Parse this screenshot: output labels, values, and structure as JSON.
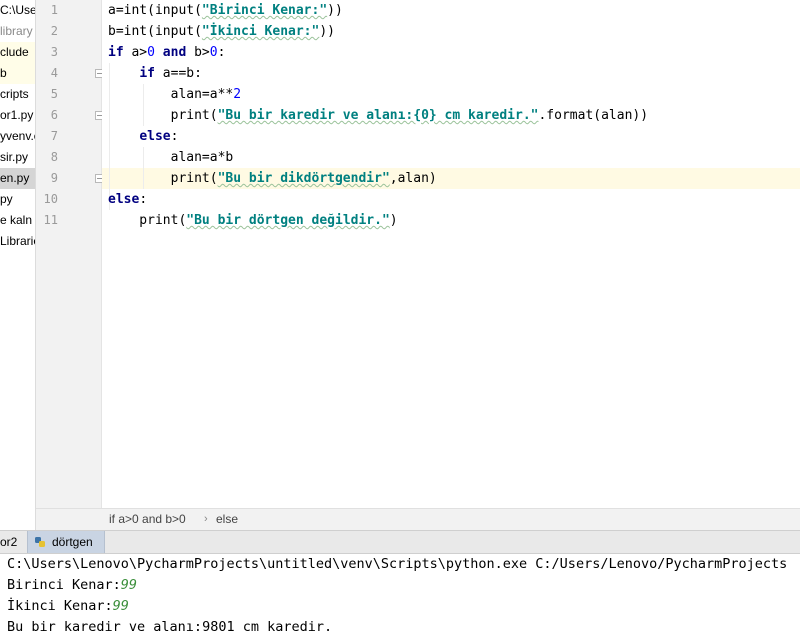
{
  "sidebar": {
    "items": [
      {
        "label": "C:\\Use",
        "dim": false
      },
      {
        "label": "library",
        "dim": true
      },
      {
        "label": "clude",
        "dim": false
      },
      {
        "label": "b",
        "dim": false
      },
      {
        "label": "cripts",
        "dim": false
      },
      {
        "label": "or1.py",
        "dim": false
      },
      {
        "label": "yvenv.c",
        "dim": false
      },
      {
        "label": "sir.py",
        "dim": false
      },
      {
        "label": "en.py",
        "dim": false
      },
      {
        "label": "py",
        "dim": false
      },
      {
        "label": "e kaln",
        "dim": false
      },
      {
        "label": "Librarie",
        "dim": false
      }
    ]
  },
  "editor": {
    "line_numbers": [
      "1",
      "2",
      "3",
      "4",
      "5",
      "6",
      "7",
      "8",
      "9",
      "10",
      "11"
    ],
    "lines": [
      [
        {
          "t": "a=int(input(",
          "c": "blt"
        },
        {
          "t": "\"Birinci Kenar:\"",
          "c": "str"
        },
        {
          "t": "))",
          "c": "blt"
        }
      ],
      [
        {
          "t": "b=int(input(",
          "c": "blt"
        },
        {
          "t": "\"İkinci Kenar:\"",
          "c": "str"
        },
        {
          "t": "))",
          "c": "blt"
        }
      ],
      [
        {
          "t": "if ",
          "c": "kw"
        },
        {
          "t": "a>",
          "c": "blt"
        },
        {
          "t": "0",
          "c": "num"
        },
        {
          "t": " and ",
          "c": "kw"
        },
        {
          "t": "b>",
          "c": "blt"
        },
        {
          "t": "0",
          "c": "num"
        },
        {
          "t": ":",
          "c": "blt"
        }
      ],
      [
        {
          "t": "    ",
          "c": "blt"
        },
        {
          "t": "if ",
          "c": "kw"
        },
        {
          "t": "a==b:",
          "c": "blt"
        }
      ],
      [
        {
          "t": "        alan=a**",
          "c": "blt"
        },
        {
          "t": "2",
          "c": "num"
        }
      ],
      [
        {
          "t": "        print(",
          "c": "blt"
        },
        {
          "t": "\"Bu bir karedir ve alanı:{0} cm karedir.\"",
          "c": "str"
        },
        {
          "t": ".format(alan))",
          "c": "blt"
        }
      ],
      [
        {
          "t": "    ",
          "c": "blt"
        },
        {
          "t": "else",
          "c": "kw"
        },
        {
          "t": ":",
          "c": "blt"
        }
      ],
      [
        {
          "t": "        alan=a*b",
          "c": "blt"
        }
      ],
      [
        {
          "t": "        print(",
          "c": "blt"
        },
        {
          "t": "\"Bu bir dikdörtgendir\"",
          "c": "str"
        },
        {
          "t": ",alan)",
          "c": "blt"
        }
      ],
      [
        {
          "t": "else",
          "c": "kw"
        },
        {
          "t": ":",
          "c": "blt"
        }
      ],
      [
        {
          "t": "    print(",
          "c": "blt"
        },
        {
          "t": "\"Bu bir dörtgen değildir.\"",
          "c": "str"
        },
        {
          "t": ")",
          "c": "blt"
        }
      ]
    ]
  },
  "breadcrumb": {
    "items": [
      "if a>0 and b>0",
      "else"
    ],
    "separator": "›"
  },
  "run_tabs": {
    "tabs": [
      {
        "label": "or2",
        "active": false
      },
      {
        "label": "dörtgen",
        "active": true
      }
    ]
  },
  "console": {
    "lines": [
      [
        {
          "t": "C:\\Users\\Lenovo\\PycharmProjects\\untitled\\venv\\Scripts\\python.exe C:/Users/Lenovo/PycharmProjects",
          "c": "out"
        }
      ],
      [
        {
          "t": "Birinci Kenar:",
          "c": "out"
        },
        {
          "t": "99",
          "c": "in"
        }
      ],
      [
        {
          "t": "İkinci Kenar:",
          "c": "out"
        },
        {
          "t": "99",
          "c": "in"
        }
      ],
      [
        {
          "t": "Bu bir karedir ve alanı:9801 cm karedir.",
          "c": "out"
        }
      ]
    ]
  },
  "colors": {
    "keyword": "#000080",
    "string": "#008080",
    "number": "#0000ff",
    "console_input": "#3b8f3b",
    "current_line": "#fffae3"
  }
}
